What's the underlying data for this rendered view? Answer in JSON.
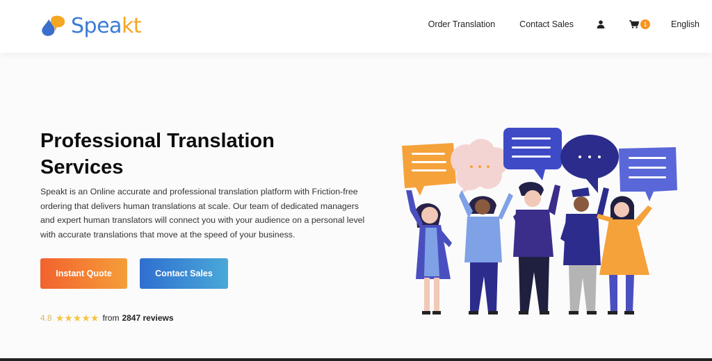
{
  "header": {
    "logo": {
      "text_main": "Spea",
      "text_accent": "kt"
    },
    "nav": {
      "order_translation": "Order Translation",
      "contact_sales": "Contact Sales",
      "cart_count": "1",
      "language": "English"
    },
    "icons": {
      "user": "user-icon",
      "cart": "cart-icon"
    }
  },
  "hero": {
    "title": "Professional Translation Services",
    "description": "Speakt is an Online accurate and professional translation platform with Friction-free ordering that delivers human translations at scale. Our team of dedicated managers and expert human translators will connect you with your audience on a personal level with accurate translations that move at the speed of your business.",
    "buttons": {
      "instant_quote": "Instant Quote",
      "contact_sales": "Contact Sales"
    },
    "rating": {
      "score": "4.8",
      "stars": "★★★★★",
      "from_label": "from",
      "reviews": "2847 reviews"
    }
  },
  "colors": {
    "brand_blue": "#3b7bd4",
    "brand_orange": "#f5a623",
    "quote_gradient_start": "#f2622e",
    "quote_gradient_end": "#f59e3a",
    "sales_gradient_start": "#2f6fd0",
    "sales_gradient_end": "#4aa8d8",
    "star": "#f5c542"
  }
}
